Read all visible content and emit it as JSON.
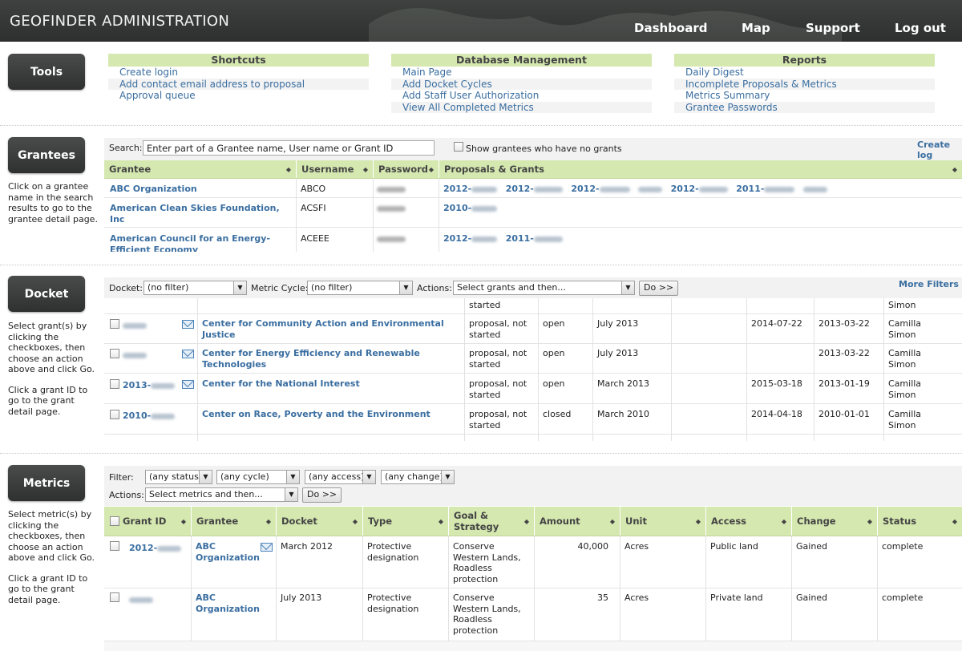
{
  "header": {
    "title": "GEOFINDER ADMINISTRATION",
    "nav": [
      "Dashboard",
      "Map",
      "Support",
      "Log out"
    ]
  },
  "tools": {
    "label": "Tools",
    "columns": [
      {
        "title": "Shortcuts",
        "links": [
          "Create login",
          "Add contact email address to proposal",
          "Approval queue"
        ]
      },
      {
        "title": "Database Management",
        "links": [
          "Main Page",
          "Add Docket Cycles",
          "Add Staff User Authorization",
          "View All Completed Metrics"
        ]
      },
      {
        "title": "Reports",
        "links": [
          "Daily Digest",
          "Incomplete Proposals & Metrics",
          "Metrics Summary",
          "Grantee Passwords"
        ]
      }
    ]
  },
  "grantees": {
    "label": "Grantees",
    "help": "Click on a grantee name in the search results to go to the grantee detail page.",
    "search_label": "Search:",
    "search_value": "Enter part of a Grantee name, User name or Grant ID",
    "no_grants_label": "Show grantees who have no grants",
    "create_link": "Create log",
    "columns": [
      "Grantee",
      "Username",
      "Password",
      "Proposals & Grants"
    ],
    "rows": [
      {
        "name": "ABC Organization",
        "username": "ABCO",
        "grants": [
          "2012-",
          "2012-",
          "2012-",
          "",
          "2012-",
          "2011-",
          ""
        ]
      },
      {
        "name": "American Clean Skies Foundation, Inc",
        "username": "ACSFI",
        "grants": [
          "2010-"
        ]
      },
      {
        "name": "American Council for an Energy-Efficient Economy",
        "username": "ACEEE",
        "grants": [
          "2012-",
          "2011-"
        ]
      }
    ]
  },
  "docket": {
    "label": "Docket",
    "help1": "Select grant(s) by clicking the checkboxes, then choose an action above and click Go.",
    "help2": "Click a grant ID to go to the grant detail page.",
    "docket_label": "Docket:",
    "docket_value": "(no filter)",
    "cycle_label": "Metric Cycle:",
    "cycle_value": "(no filter)",
    "actions_label": "Actions:",
    "actions_value": "Select grants and then...",
    "do_button": "Do >>",
    "more_filters": "More Filters",
    "partial_top": {
      "status": "started",
      "owner": "Simon"
    },
    "rows": [
      {
        "id": "",
        "org": "Center for Community Action and Environmental Justice",
        "status": "proposal, not started",
        "state": "open",
        "cycle": "July 2013",
        "date1": "2014-07-22",
        "date2": "2013-03-22",
        "owner": "Camilla Simon"
      },
      {
        "id": "",
        "org": "Center for Energy Efficiency and Renewable Technologies",
        "status": "proposal, not started",
        "state": "open",
        "cycle": "July 2013",
        "date1": "",
        "date2": "2013-03-22",
        "owner": "Camilla Simon"
      },
      {
        "id": "2013-",
        "org": "Center for the National Interest",
        "status": "proposal, not started",
        "state": "open",
        "cycle": "March 2013",
        "date1": "2015-03-18",
        "date2": "2013-01-19",
        "owner": "Camilla Simon"
      },
      {
        "id": "2010-",
        "org": "Center on Race, Poverty and the Environment",
        "status": "proposal, not started",
        "state": "closed",
        "cycle": "March 2010",
        "date1": "2014-04-18",
        "date2": "2010-01-01",
        "owner": "Camilla Simon"
      }
    ]
  },
  "metrics": {
    "label": "Metrics",
    "help1": "Select metric(s) by clicking the checkboxes, then choose an action above and click Go.",
    "help2": "Click a grant ID to go to the grant detail page.",
    "filter_label": "Filter:",
    "filters": [
      "(any status)",
      "(any cycle)",
      "(any access)",
      "(any change)"
    ],
    "actions_label": "Actions:",
    "actions_value": "Select metrics and then...",
    "do_button": "Do >>",
    "columns": [
      "Grant ID",
      "Grantee",
      "Docket",
      "Type",
      "Goal & Strategy",
      "Amount",
      "Unit",
      "Access",
      "Change",
      "Status"
    ],
    "rows": [
      {
        "id": "2012-",
        "grantee": "ABC Organization",
        "docket": "March 2012",
        "type": "Protective designation",
        "goal": "Conserve Western Lands, Roadless protection",
        "amount": "40,000",
        "unit": "Acres",
        "access": "Public land",
        "change": "Gained",
        "status": "complete"
      },
      {
        "id": "",
        "grantee": "ABC Organization",
        "docket": "July 2013",
        "type": "Protective designation",
        "goal": "Conserve Western Lands, Roadless protection",
        "amount": "35",
        "unit": "Acres",
        "access": "Private land",
        "change": "Gained",
        "status": "complete"
      }
    ]
  }
}
